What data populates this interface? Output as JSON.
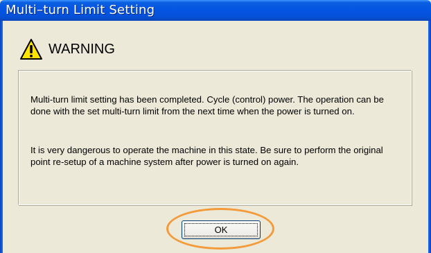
{
  "window": {
    "title": "Multi–turn Limit Setting"
  },
  "warning": {
    "label": "WARNING",
    "icon": "warning-triangle-icon"
  },
  "message": {
    "paragraph1": "Multi-turn limit setting has been completed. Cycle (control) power. The operation can be done with the set multi-turn limit from the next time when the power is turned on.",
    "paragraph2": "It is very dangerous to operate the machine in this state. Be sure to perform the original point re-setup of a machine system after power is turned on again."
  },
  "buttons": {
    "ok_label": "OK"
  },
  "colors": {
    "titlebar": "#0554e3",
    "dialog_bg": "#ece9d8",
    "warning_yellow": "#ffe400",
    "highlight_orange": "#f39a3a"
  }
}
